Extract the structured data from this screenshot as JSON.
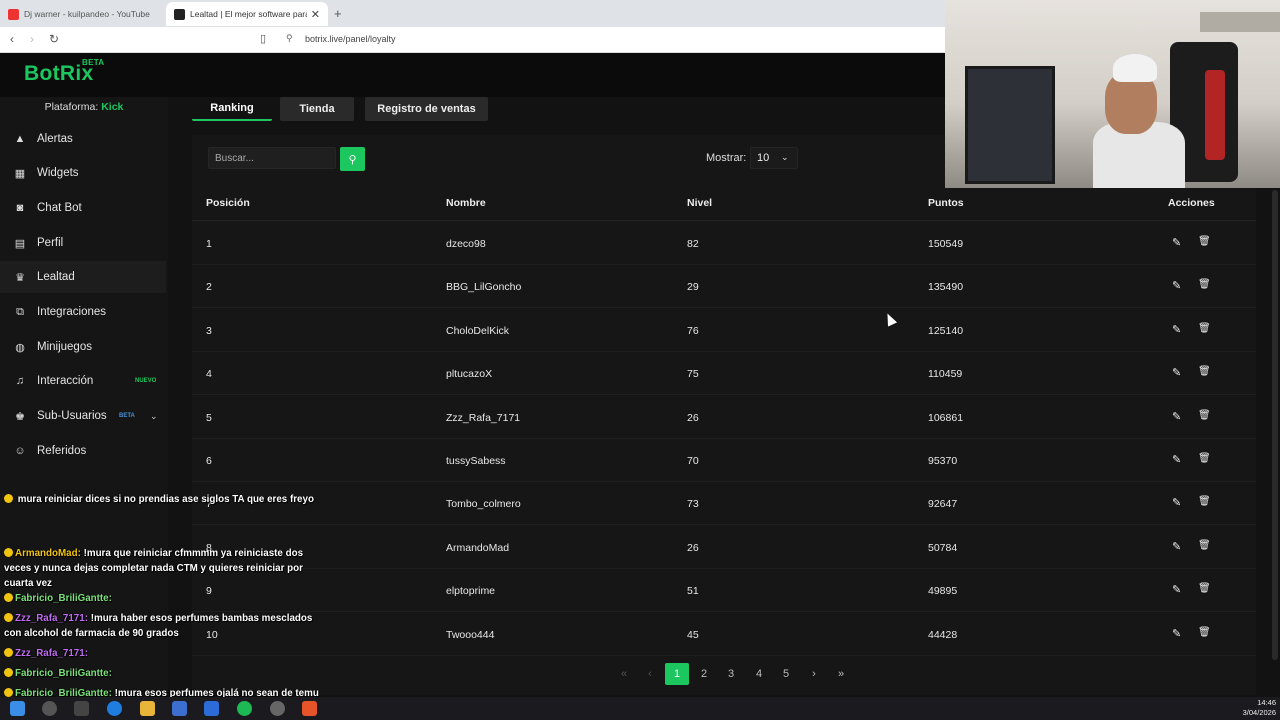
{
  "browser": {
    "tabs": [
      {
        "title": "Dj warner - kuilpandeo - YouTube",
        "active": false
      },
      {
        "title": "Lealtad | El mejor software para",
        "active": true
      }
    ],
    "url": "botrix.live/panel/loyalty"
  },
  "app": {
    "logo": "BotRix",
    "logo_badge": "BETA",
    "platform_label": "Plataforma:",
    "platform_value": "Kick",
    "brand_color": "#1cc760"
  },
  "sidebar": {
    "items": [
      {
        "label": "Alertas",
        "icon": "warning-icon"
      },
      {
        "label": "Widgets",
        "icon": "grid-icon"
      },
      {
        "label": "Chat Bot",
        "icon": "robot-icon"
      },
      {
        "label": "Perfil",
        "icon": "id-card-icon"
      },
      {
        "label": "Lealtad",
        "icon": "trophy-icon",
        "active": true
      },
      {
        "label": "Integraciones",
        "icon": "plug-icon"
      },
      {
        "label": "Minijuegos",
        "icon": "gamepad-icon"
      },
      {
        "label": "Interacción",
        "icon": "music-icon",
        "tag": "NUEVO"
      },
      {
        "label": "Sub-Usuarios",
        "icon": "users-icon",
        "tag": "BETA"
      },
      {
        "label": "Referidos",
        "icon": "user-group-icon"
      }
    ]
  },
  "main": {
    "tabs": [
      {
        "label": "Ranking",
        "active": true
      },
      {
        "label": "Tienda"
      },
      {
        "label": "Registro de ventas"
      }
    ],
    "search_placeholder": "Buscar...",
    "show_label": "Mostrar:",
    "show_value": "10",
    "columns": [
      "Posición",
      "Nombre",
      "Nivel",
      "Puntos",
      "Acciones"
    ],
    "rows": [
      {
        "pos": "1",
        "name": "dzeco98",
        "level": "82",
        "points": "150549"
      },
      {
        "pos": "2",
        "name": "BBG_LilGoncho",
        "level": "29",
        "points": "135490"
      },
      {
        "pos": "3",
        "name": "CholoDelKick",
        "level": "76",
        "points": "125140"
      },
      {
        "pos": "4",
        "name": "pltucazoX",
        "level": "75",
        "points": "110459"
      },
      {
        "pos": "5",
        "name": "Zzz_Rafa_7171",
        "level": "26",
        "points": "106861"
      },
      {
        "pos": "6",
        "name": "tussySabess",
        "level": "70",
        "points": "95370"
      },
      {
        "pos": "7",
        "name": "Tombo_colmero",
        "level": "73",
        "points": "92647"
      },
      {
        "pos": "8",
        "name": "ArmandoMad",
        "level": "26",
        "points": "50784"
      },
      {
        "pos": "9",
        "name": "elptoprime",
        "level": "51",
        "points": "49895"
      },
      {
        "pos": "10",
        "name": "Twooo444",
        "level": "45",
        "points": "44428"
      }
    ],
    "pagination": {
      "first": "«",
      "prev": "‹",
      "pages": [
        "1",
        "2",
        "3",
        "4",
        "5"
      ],
      "current": "1",
      "next": "›",
      "last": "»"
    }
  },
  "chat": {
    "lines": [
      {
        "user": "",
        "text": "mura reiniciar dices si no prendias ase siglos TA que eres freyo"
      },
      {
        "user": "ArmandoMad:",
        "text": "!mura que reiniciar cfmmmm ya reiniciaste dos veces y nunca dejas completar nada CTM y quieres reiniciar por cuarta vez"
      },
      {
        "user": "Fabricio_BriliGantte:",
        "text": ""
      },
      {
        "user": "Zzz_Rafa_7171:",
        "text": "!mura haber esos perfumes bambas mesclados con alcohol de farmacia de 90 grados"
      },
      {
        "user": "Zzz_Rafa_7171:",
        "text": ""
      },
      {
        "user": "Fabricio_BriliGantte:",
        "text": ""
      },
      {
        "user": "Fabricio_BriliGantte:",
        "text": "!mura esos perfumes ojalá no sean de temu chuisito"
      }
    ]
  },
  "taskbar": {
    "time": "14:46",
    "date": "3/04/2026"
  }
}
